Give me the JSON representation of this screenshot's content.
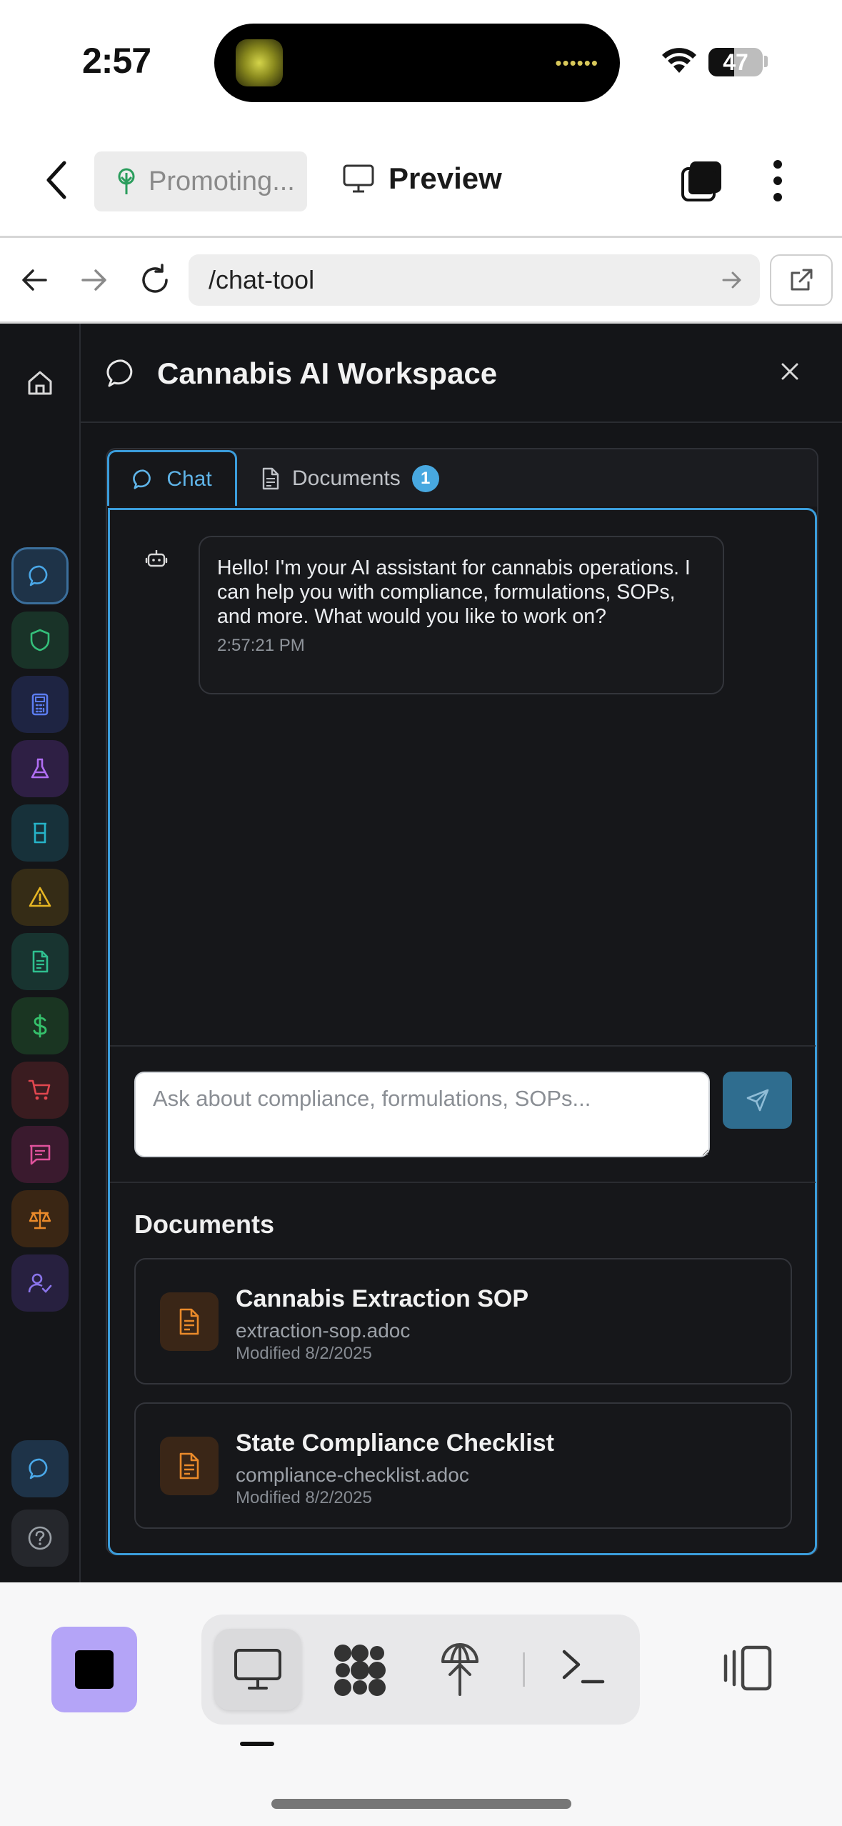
{
  "status_bar": {
    "time": "2:57",
    "battery": "47",
    "battery_level": 0.47
  },
  "top_bar": {
    "project_chip": "Promoting...",
    "preview_label": "Preview"
  },
  "browser": {
    "url": "/chat-tool"
  },
  "workspace": {
    "title": "Cannabis AI Workspace",
    "tabs": [
      {
        "label": "Chat",
        "active": true
      },
      {
        "label": "Documents",
        "badge": "1"
      }
    ],
    "messages": [
      {
        "role": "assistant",
        "text": "Hello! I'm your AI assistant for cannabis operations. I can help you with compliance, formulations, SOPs, and more. What would you like to work on?",
        "time": "2:57:21 PM"
      }
    ],
    "input": {
      "placeholder": "Ask about compliance, formulations, SOPs...",
      "value": ""
    },
    "documents": {
      "heading": "Documents",
      "items": [
        {
          "title": "Cannabis Extraction SOP",
          "file": "extraction-sop.adoc",
          "modified": "Modified 8/2/2025"
        },
        {
          "title": "State Compliance Checklist",
          "file": "compliance-checklist.adoc",
          "modified": "Modified 8/2/2025"
        }
      ]
    }
  },
  "sidebar": {
    "items": [
      {
        "icon": "chat-icon",
        "color": "#3b9ddb"
      },
      {
        "icon": "shield-icon",
        "color": "#34c07a"
      },
      {
        "icon": "calculator-icon",
        "color": "#5b7cf0"
      },
      {
        "icon": "flask-icon",
        "color": "#b06ef2"
      },
      {
        "icon": "beaker-icon",
        "color": "#26b3c8"
      },
      {
        "icon": "warning-icon",
        "color": "#e5b523"
      },
      {
        "icon": "document-icon",
        "color": "#2fbf8f"
      },
      {
        "icon": "dollar-icon",
        "color": "#35c06b"
      },
      {
        "icon": "cart-icon",
        "color": "#e0474f"
      },
      {
        "icon": "message-icon",
        "color": "#e0529c"
      },
      {
        "icon": "scale-icon",
        "color": "#ea8a2a"
      },
      {
        "icon": "user-check-icon",
        "color": "#8a74ea"
      }
    ],
    "footer": [
      {
        "icon": "chat-icon",
        "color": "#3b9ddb"
      },
      {
        "icon": "help-icon",
        "color": "#9aa0a6"
      }
    ]
  },
  "colors": {
    "accent": "#3b9ddb",
    "background": "#141518",
    "stop_button": "#b4a4f7"
  }
}
